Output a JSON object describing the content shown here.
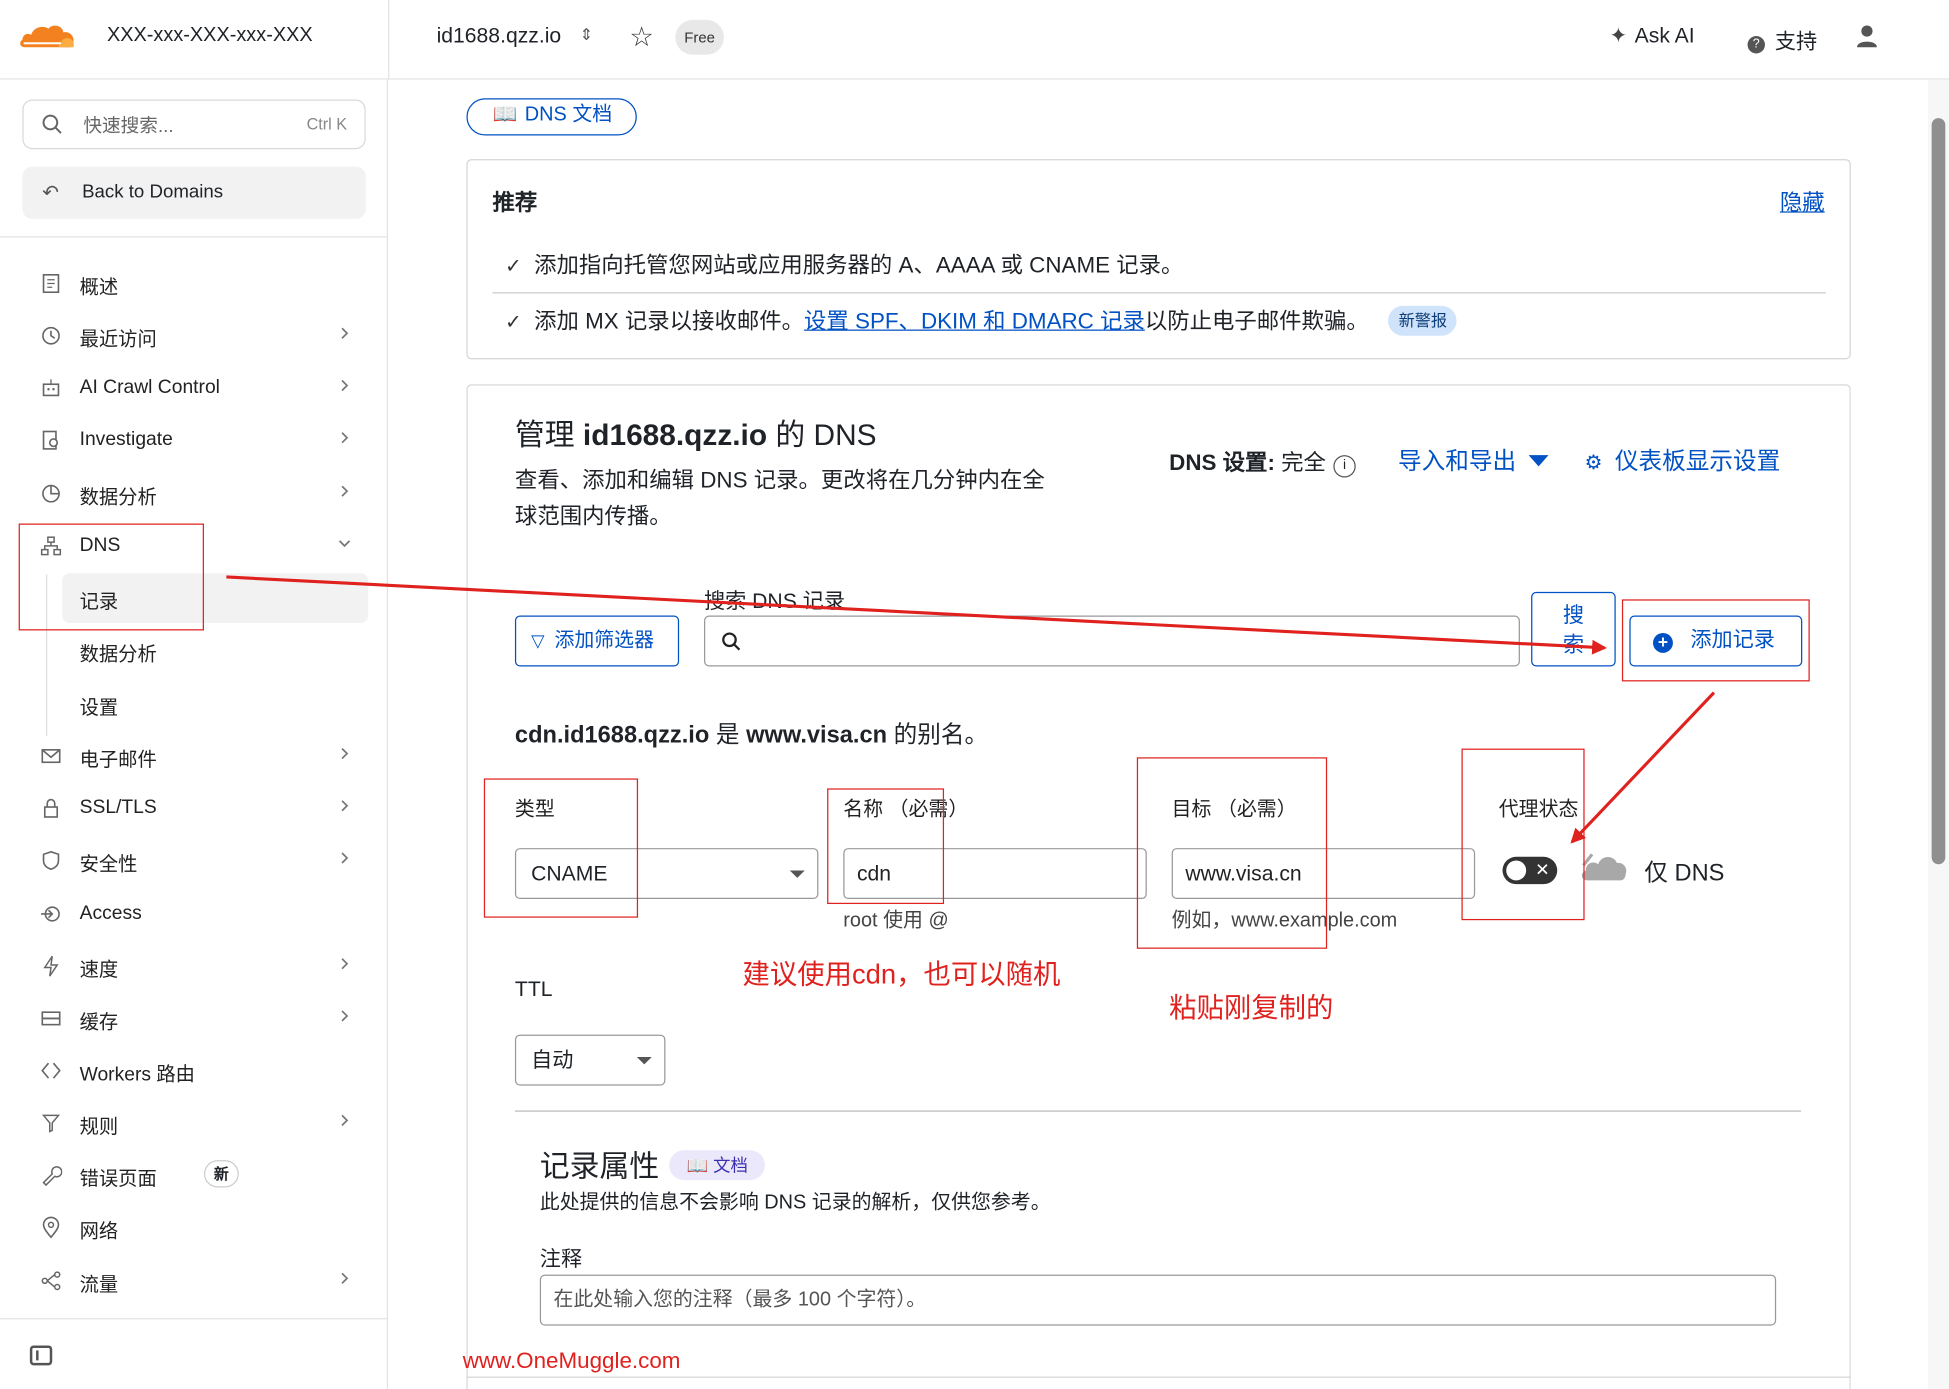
{
  "header": {
    "account_name": "XXX-xxx-XXX-xxx-XXX",
    "domain": "id1688.qzz.io",
    "plan_badge": "Free",
    "ask_ai": "Ask AI",
    "support": "支持",
    "brand_color": "#f48120"
  },
  "sidebar": {
    "search_placeholder": "快速搜索...",
    "search_shortcut": "Ctrl K",
    "back_label": "Back to Domains",
    "items": [
      {
        "label": "概述",
        "icon": "document-icon",
        "chevron": false
      },
      {
        "label": "最近访问",
        "icon": "history-icon",
        "chevron": true
      },
      {
        "label": "AI Crawl Control",
        "icon": "robot-icon",
        "chevron": true
      },
      {
        "label": "Investigate",
        "icon": "investigate-icon",
        "chevron": true
      },
      {
        "label": "数据分析",
        "icon": "chart-pie-icon",
        "chevron": true
      },
      {
        "label": "DNS",
        "icon": "sitemap-icon",
        "chevron": "down"
      },
      {
        "label": "记录",
        "sub": true,
        "active": true
      },
      {
        "label": "数据分析",
        "sub": true
      },
      {
        "label": "设置",
        "sub": true
      },
      {
        "label": "电子邮件",
        "icon": "email-icon",
        "chevron": true
      },
      {
        "label": "SSL/TLS",
        "icon": "lock-icon",
        "chevron": true
      },
      {
        "label": "安全性",
        "icon": "shield-icon",
        "chevron": true
      },
      {
        "label": "Access",
        "icon": "access-icon",
        "chevron": false
      },
      {
        "label": "速度",
        "icon": "bolt-icon",
        "chevron": true
      },
      {
        "label": "缓存",
        "icon": "cache-icon",
        "chevron": true
      },
      {
        "label": "Workers 路由",
        "icon": "workers-icon",
        "chevron": false
      },
      {
        "label": "规则",
        "icon": "rules-icon",
        "chevron": true
      },
      {
        "label": "错误页面",
        "icon": "wrench-icon",
        "chevron": false,
        "badge": "新"
      },
      {
        "label": "网络",
        "icon": "location-icon",
        "chevron": false
      },
      {
        "label": "流量",
        "icon": "traffic-icon",
        "chevron": true
      }
    ]
  },
  "main": {
    "dns_doc_button": "DNS 文档",
    "recommend": {
      "title": "推荐",
      "hide": "隐藏",
      "item1": "添加指向托管您网站或应用服务器的 A、AAAA 或 CNAME 记录。",
      "item2_prefix": "添加 MX 记录以接收邮件。",
      "item2_link": "设置 SPF、DKIM 和 DMARC 记录",
      "item2_suffix": "以防止电子邮件欺骗。",
      "item2_badge": "新警报"
    },
    "manage": {
      "title_prefix": "管理 ",
      "title_domain": "id1688.qzz.io",
      "title_suffix": " 的 DNS",
      "desc": "查看、添加和编辑 DNS 记录。更改将在几分钟内在全球范围内传播。",
      "dns_setting_label": "DNS 设置:",
      "dns_setting_value": "完全",
      "import_export": "导入和导出",
      "dashboard_settings": "仪表板显示设置",
      "search_label": "搜索 DNS 记录",
      "filter_button": "添加筛选器",
      "search_button": "搜索",
      "add_record": "添加记录",
      "alias_host": "cdn.id1688.qzz.io",
      "alias_mid": " 是 ",
      "alias_target": "www.visa.cn",
      "alias_end": " 的别名。"
    },
    "form": {
      "type_label": "类型",
      "type_value": "CNAME",
      "name_label": "名称 （必需）",
      "name_value": "cdn",
      "name_help": "root 使用 @",
      "target_label": "目标 （必需）",
      "target_value": "www.visa.cn",
      "target_help": "例如，www.example.com",
      "proxy_label": "代理状态",
      "proxy_value": "仅 DNS",
      "ttl_label": "TTL",
      "ttl_value": "自动"
    },
    "attributes": {
      "title": "记录属性",
      "doc": "文档",
      "desc": "此处提供的信息不会影响 DNS 记录的解析，仅供您参考。",
      "note_label": "注释",
      "note_placeholder": "在此处输入您的注释（最多 100 个字符）。"
    }
  },
  "annotations": {
    "name_tip": "建议使用cdn，也可以随机",
    "target_tip": "粘贴刚复制的",
    "watermark": "www.OneMuggle.com",
    "color": "#e0221f"
  }
}
